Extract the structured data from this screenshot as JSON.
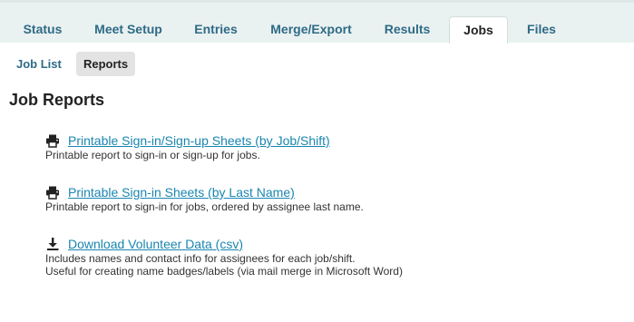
{
  "nav": {
    "tabs": [
      {
        "label": "Status"
      },
      {
        "label": "Meet Setup"
      },
      {
        "label": "Entries"
      },
      {
        "label": "Merge/Export"
      },
      {
        "label": "Results"
      },
      {
        "label": "Jobs",
        "active": true
      },
      {
        "label": "Files"
      }
    ]
  },
  "subnav": {
    "items": [
      {
        "label": "Job List"
      },
      {
        "label": "Reports",
        "active": true
      }
    ]
  },
  "page": {
    "title": "Job Reports"
  },
  "reports": [
    {
      "icon": "printer-icon",
      "link": "Printable Sign-in/Sign-up Sheets (by Job/Shift)",
      "desc": [
        "Printable report to sign-in or sign-up for jobs."
      ]
    },
    {
      "icon": "printer-icon",
      "link": "Printable Sign-in Sheets (by Last Name)",
      "desc": [
        "Printable report to sign-in for jobs, ordered by assignee last name."
      ]
    },
    {
      "icon": "download-icon",
      "link": "Download Volunteer Data (csv)",
      "desc": [
        "Includes names and contact info for assignees for each job/shift.",
        "Useful for creating name badges/labels (via mail merge in Microsoft Word)"
      ]
    }
  ],
  "colors": {
    "link": "#1a86b0",
    "tab_text": "#2e6b86",
    "band": "#eaf1f1"
  }
}
